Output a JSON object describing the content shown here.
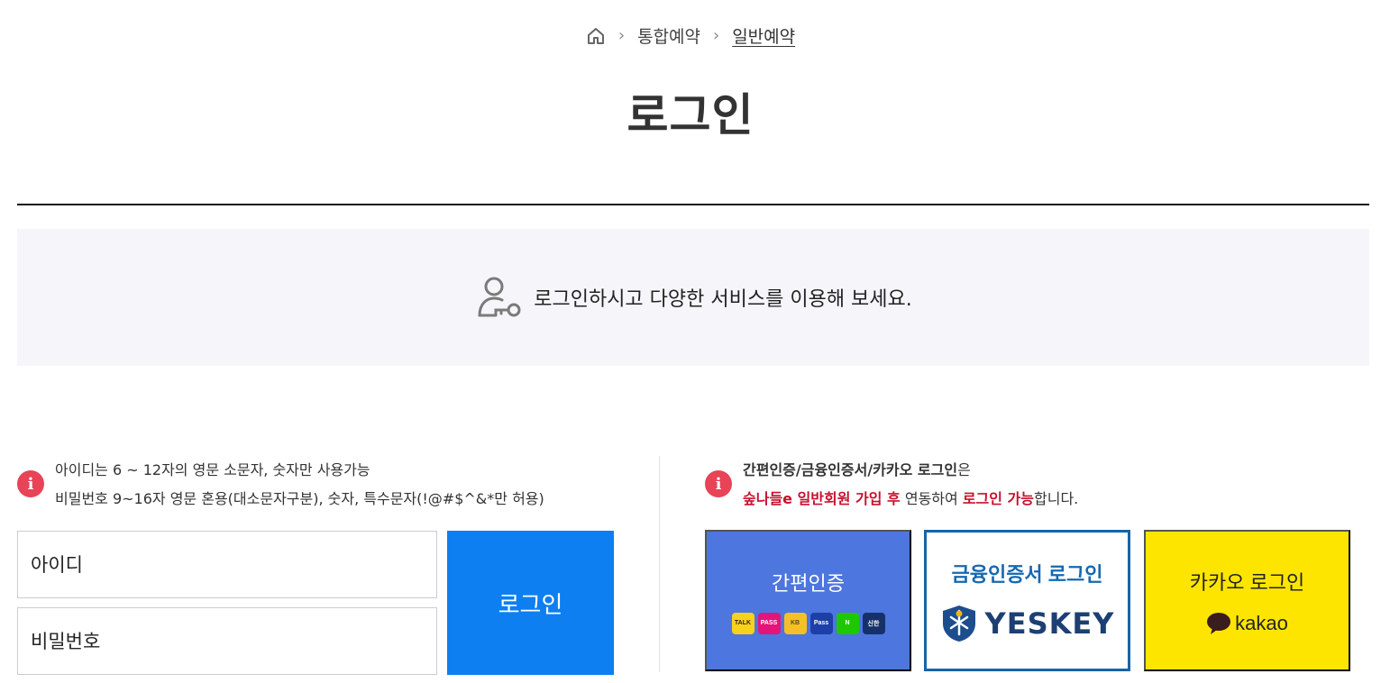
{
  "breadcrumb": {
    "items": [
      "통합예약",
      "일반예약"
    ]
  },
  "page": {
    "title": "로그인"
  },
  "banner": {
    "message": "로그인하시고 다양한 서비스를 이용해 보세요."
  },
  "login": {
    "notice_line1": "아이디는 6 ~ 12자의 영문 소문자, 숫자만 사용가능",
    "notice_line2": "비밀번호 9~16자 영문 혼용(대소문자구분), 숫자, 특수문자(!@#$^&*만 허용)",
    "id_placeholder": "아이디",
    "pw_placeholder": "비밀번호",
    "button_label": "로그인"
  },
  "auth": {
    "notice_bold": "간편인증/금융인증서/카카오 로그인",
    "notice_suffix1": "은",
    "notice_red1": "숲나들e 일반회원 가입 후",
    "notice_mid": " 연동하여 ",
    "notice_red2": "로그인 가능",
    "notice_suffix2": "합니다.",
    "simple": {
      "label": "간편인증",
      "chips": [
        {
          "text": "TALK",
          "color": "#f7d21c",
          "fg": "#3a1d1d"
        },
        {
          "text": "PASS",
          "color": "#e3157a",
          "fg": "#ffffff"
        },
        {
          "text": "KB",
          "color": "#f5c026",
          "fg": "#5a4a20"
        },
        {
          "text": "Pass",
          "color": "#1f3fa8",
          "fg": "#ffffff"
        },
        {
          "text": "N",
          "color": "#1ec800",
          "fg": "#ffffff"
        },
        {
          "text": "신한",
          "color": "#16306b",
          "fg": "#ffffff"
        }
      ]
    },
    "cert": {
      "label": "금융인증서 로그인",
      "logo_text": "YESKEY"
    },
    "kakao": {
      "label": "카카오 로그인",
      "logo_text": "kakao"
    }
  },
  "colors": {
    "login_button": "#0d7ff1",
    "simple_auth": "#4d76de",
    "cert_border": "#1565a8",
    "kakao": "#fee500",
    "alert": "#e84357",
    "emphasis": "#c8102e"
  }
}
